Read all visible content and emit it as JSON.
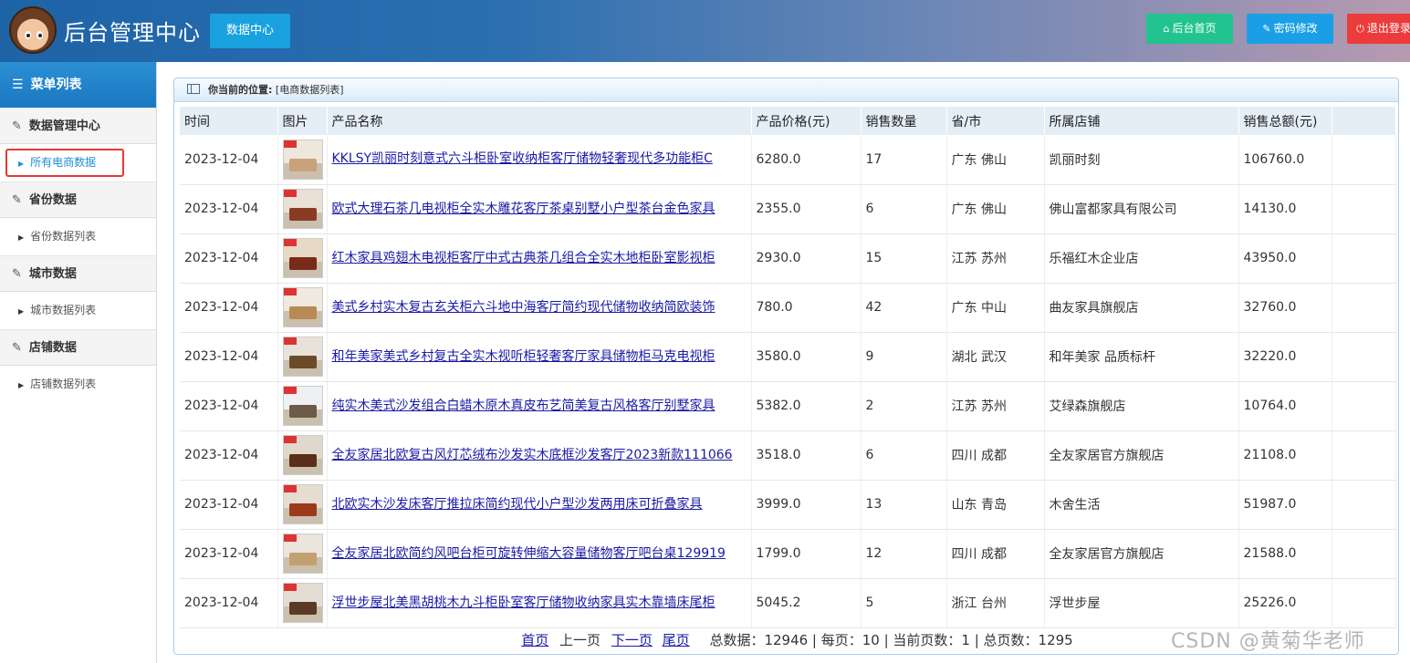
{
  "header": {
    "title": "后台管理中心",
    "tab": "数据中心",
    "buttons": {
      "home": "后台首页",
      "password": "密码修改",
      "logout": "退出登录"
    }
  },
  "sidebar": {
    "menu_title": "菜单列表",
    "groups": [
      {
        "label": "数据管理中心",
        "sub": "所有电商数据"
      },
      {
        "label": "省份数据",
        "sub": "省份数据列表"
      },
      {
        "label": "城市数据",
        "sub": "城市数据列表"
      },
      {
        "label": "店铺数据",
        "sub": "店铺数据列表"
      }
    ]
  },
  "breadcrumb": {
    "prefix": "你当前的位置:",
    "current": "[电商数据列表]"
  },
  "table": {
    "headers": [
      "时间",
      "图片",
      "产品名称",
      "产品价格(元)",
      "销售数量",
      "省/市",
      "所属店铺",
      "销售总额(元)"
    ],
    "rows": [
      {
        "time": "2023-12-04",
        "name": "KKLSY凯丽时刻意式六斗柜卧室收纳柜客厅储物轻奢现代多功能柜C",
        "price": "6280.0",
        "qty": "17",
        "region": "广东 佛山",
        "shop": "凯丽时刻",
        "total": "106760.0"
      },
      {
        "time": "2023-12-04",
        "name": "欧式大理石茶几电视柜全实木雕花客厅茶桌别墅小户型茶台金色家具",
        "price": "2355.0",
        "qty": "6",
        "region": "广东 佛山",
        "shop": "佛山富都家具有限公司",
        "total": "14130.0"
      },
      {
        "time": "2023-12-04",
        "name": "红木家具鸡翅木电视柜客厅中式古典茶几组合全实木地柜卧室影视柜",
        "price": "2930.0",
        "qty": "15",
        "region": "江苏 苏州",
        "shop": "乐福红木企业店",
        "total": "43950.0"
      },
      {
        "time": "2023-12-04",
        "name": "美式乡村实木复古玄关柜六斗地中海客厅简约现代储物收纳简欧装饰",
        "price": "780.0",
        "qty": "42",
        "region": "广东 中山",
        "shop": "曲友家具旗舰店",
        "total": "32760.0"
      },
      {
        "time": "2023-12-04",
        "name": "和年美家美式乡村复古全实木视听柜轻奢客厅家具储物柜马克电视柜",
        "price": "3580.0",
        "qty": "9",
        "region": "湖北 武汉",
        "shop": "和年美家 品质标杆",
        "total": "32220.0"
      },
      {
        "time": "2023-12-04",
        "name": "纯实木美式沙发组合白蜡木原木真皮布艺简美复古风格客厅别墅家具",
        "price": "5382.0",
        "qty": "2",
        "region": "江苏 苏州",
        "shop": "艾绿森旗舰店",
        "total": "10764.0"
      },
      {
        "time": "2023-12-04",
        "name": "全友家居北欧复古风灯芯绒布沙发实木底框沙发客厅2023新款111066",
        "price": "3518.0",
        "qty": "6",
        "region": "四川 成都",
        "shop": "全友家居官方旗舰店",
        "total": "21108.0"
      },
      {
        "time": "2023-12-04",
        "name": "北欧实木沙发床客厅推拉床简约现代小户型沙发两用床可折叠家具",
        "price": "3999.0",
        "qty": "13",
        "region": "山东 青岛",
        "shop": "木舍生活",
        "total": "51987.0"
      },
      {
        "time": "2023-12-04",
        "name": "全友家居北欧简约风吧台柜可旋转伸缩大容量储物客厅吧台桌129919",
        "price": "1799.0",
        "qty": "12",
        "region": "四川 成都",
        "shop": "全友家居官方旗舰店",
        "total": "21588.0"
      },
      {
        "time": "2023-12-04",
        "name": "浮世步屋北美黑胡桃木九斗柜卧室客厅储物收纳家具实木靠墙床尾柜",
        "price": "5045.2",
        "qty": "5",
        "region": "浙江 台州",
        "shop": "浮世步屋",
        "total": "25226.0"
      }
    ]
  },
  "pager": {
    "first": "首页",
    "prev": "上一页",
    "next": "下一页",
    "last": "尾页",
    "summary": "总数据：12946 | 每页：10 | 当前页数：1 | 总页数：1295"
  },
  "watermark": "CSDN @黄菊华老师"
}
